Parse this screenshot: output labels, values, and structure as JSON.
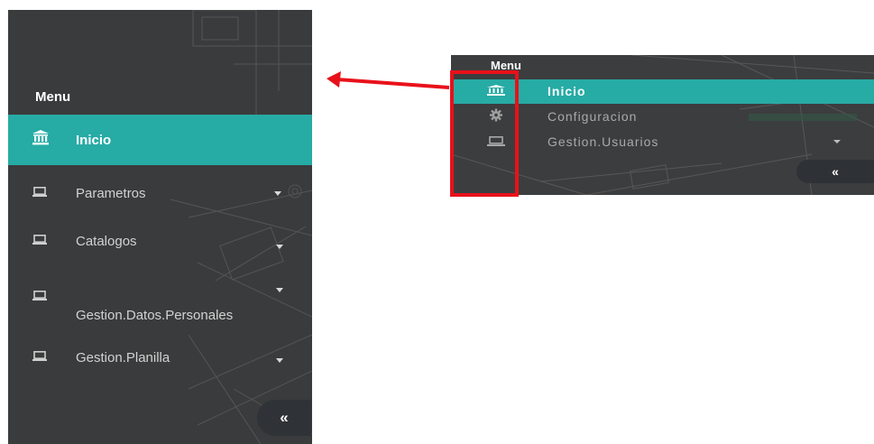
{
  "large_sidebar": {
    "menu_title": "Menu",
    "items": [
      {
        "label": "Inicio",
        "icon": "bank-icon",
        "active": true
      },
      {
        "label": "Parametros",
        "icon": "laptop-icon",
        "has_submenu": true
      },
      {
        "label": "Catalogos",
        "icon": "laptop-icon",
        "has_submenu": true
      },
      {
        "label": "Gestion.Datos.Personales",
        "icon": "laptop-icon",
        "has_submenu": true
      },
      {
        "label": "Gestion.Planilla",
        "icon": "laptop-icon",
        "has_submenu": true
      }
    ],
    "collapse_label": "«"
  },
  "small_sidebar": {
    "menu_title": "Menu",
    "items": [
      {
        "label": "Inicio",
        "icon": "bank-icon",
        "active": true
      },
      {
        "label": "Configuracion",
        "icon": "gear-icon"
      },
      {
        "label": "Gestion.Usuarios",
        "icon": "laptop-icon",
        "has_submenu": true
      }
    ],
    "collapse_label": "«"
  },
  "colors": {
    "sidebar_bg": "#3a3b3c",
    "active_bg": "#27aba5",
    "highlight": "#e8111a"
  }
}
